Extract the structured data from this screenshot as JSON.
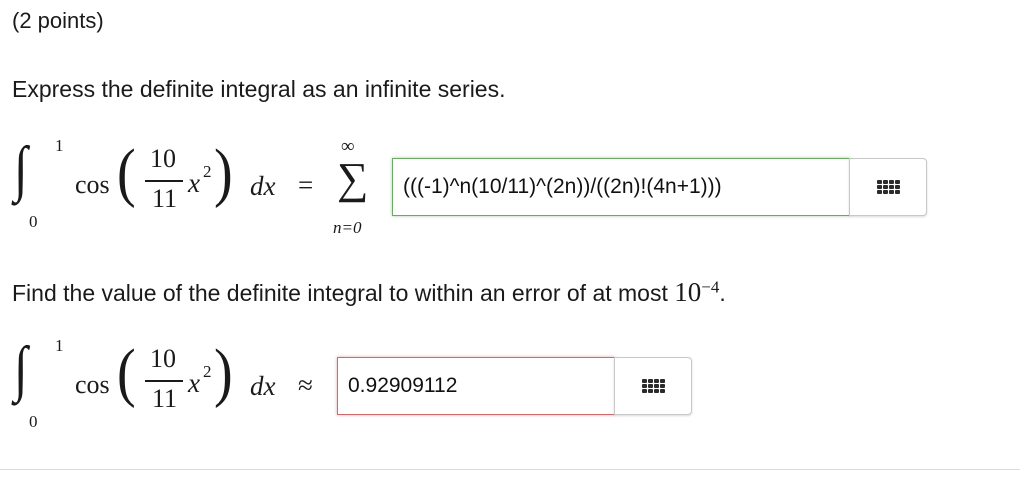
{
  "header": {
    "points": "(2 points)"
  },
  "question1": {
    "prompt": "Express the definite integral as an infinite series."
  },
  "question2": {
    "prompt": "Find the value of the definite integral to within an error of at most ",
    "error_base": "10",
    "error_exp": "−4",
    "period": "."
  },
  "integral": {
    "upper": "1",
    "lower": "0",
    "cos": "cos",
    "numerator": "10",
    "denominator": "11",
    "var": "x",
    "power": "2",
    "dx": "dx"
  },
  "series": {
    "equals": "=",
    "sigma": "∑",
    "upper": "∞",
    "lower": "n=0"
  },
  "approx": {
    "symbol": "≈"
  },
  "answer1": {
    "value": "(((-1)^n(10/11)^(2n))/((2n)!(4n+1)))",
    "status": "correct"
  },
  "answer2": {
    "value": "0.92909112",
    "status": "incorrect"
  },
  "icons": {
    "keypad": "keypad-grid-icon"
  },
  "colors": {
    "correct": "#6aaa64",
    "incorrect": "#d16b6b"
  }
}
